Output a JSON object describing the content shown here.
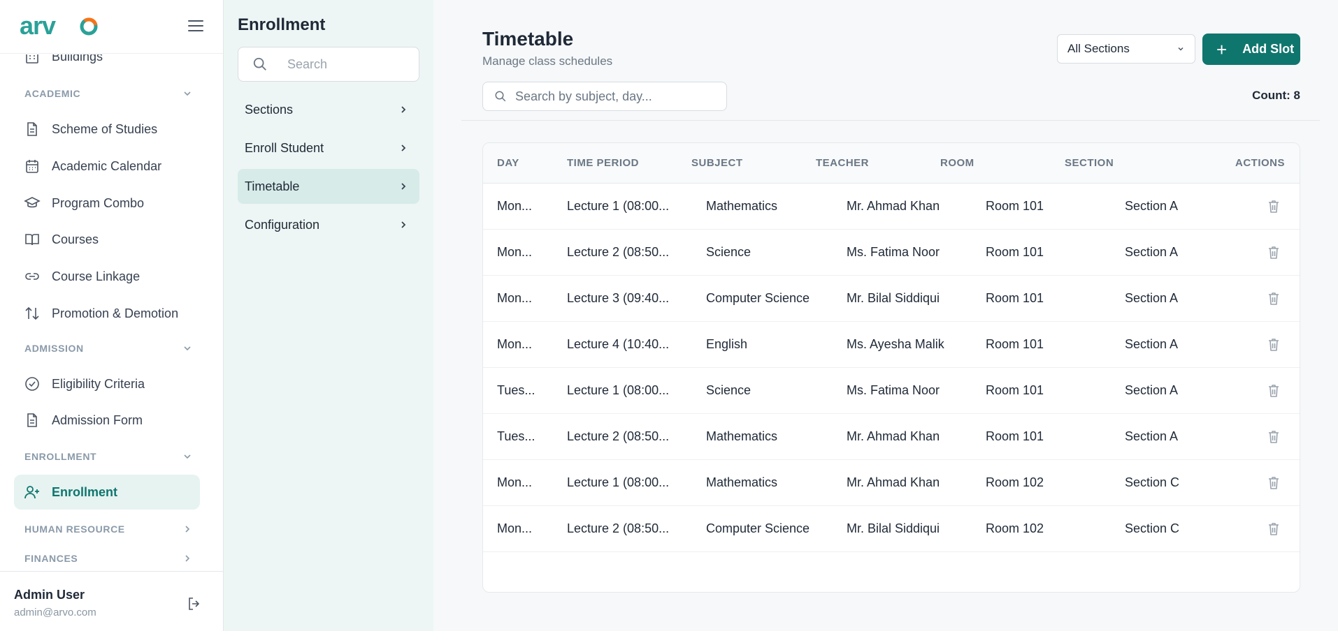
{
  "sidebar": {
    "brand": "arvo",
    "items": {
      "buildings": "Buildings",
      "scheme": "Scheme of Studies",
      "calendar": "Academic Calendar",
      "program_combo": "Program Combo",
      "courses": "Courses",
      "course_linkage": "Course Linkage",
      "promotion": "Promotion & Demotion",
      "eligibility": "Eligibility Criteria",
      "admission_form": "Admission Form",
      "enrollment": "Enrollment"
    },
    "sections": {
      "academic": "ACADEMIC",
      "admission": "ADMISSION",
      "enrollment": "ENROLLMENT",
      "human_resource": "HUMAN RESOURCE",
      "finances": "FINANCES"
    },
    "user": {
      "name": "Admin User",
      "email": "admin@arvo.com"
    }
  },
  "subpanel": {
    "title": "Enrollment",
    "search_placeholder": "Search",
    "items": [
      "Sections",
      "Enroll Student",
      "Timetable",
      "Configuration"
    ]
  },
  "main": {
    "title": "Timetable",
    "subtitle": "Manage class schedules",
    "section_filter": "All Sections",
    "add_label": "Add Slot",
    "search_placeholder": "Search by subject, day...",
    "count_label": "Count: 8",
    "columns": [
      "DAY",
      "TIME PERIOD",
      "SUBJECT",
      "TEACHER",
      "ROOM",
      "SECTION",
      "ACTIONS"
    ],
    "rows": [
      [
        "Mon...",
        "Lecture 1 (08:00...",
        "Mathematics",
        "Mr. Ahmad Khan",
        "Room 101",
        "Section A"
      ],
      [
        "Mon...",
        "Lecture 2 (08:50...",
        "Science",
        "Ms. Fatima Noor",
        "Room 101",
        "Section A"
      ],
      [
        "Mon...",
        "Lecture 3 (09:40...",
        "Computer Science",
        "Mr. Bilal Siddiqui",
        "Room 101",
        "Section A"
      ],
      [
        "Mon...",
        "Lecture 4 (10:40...",
        "English",
        "Ms. Ayesha Malik",
        "Room 101",
        "Section A"
      ],
      [
        "Tues...",
        "Lecture 1 (08:00...",
        "Science",
        "Ms. Fatima Noor",
        "Room 101",
        "Section A"
      ],
      [
        "Tues...",
        "Lecture 2 (08:50...",
        "Mathematics",
        "Mr. Ahmad Khan",
        "Room 101",
        "Section A"
      ],
      [
        "Mon...",
        "Lecture 1 (08:00...",
        "Mathematics",
        "Mr. Ahmad Khan",
        "Room 102",
        "Section C"
      ],
      [
        "Mon...",
        "Lecture 2 (08:50...",
        "Computer Science",
        "Mr. Bilal Siddiqui",
        "Room 102",
        "Section C"
      ]
    ]
  },
  "colors": {
    "accent": "#0f766e",
    "accent_light": "#e6f3f1",
    "panel_bg": "#edf6f4"
  }
}
